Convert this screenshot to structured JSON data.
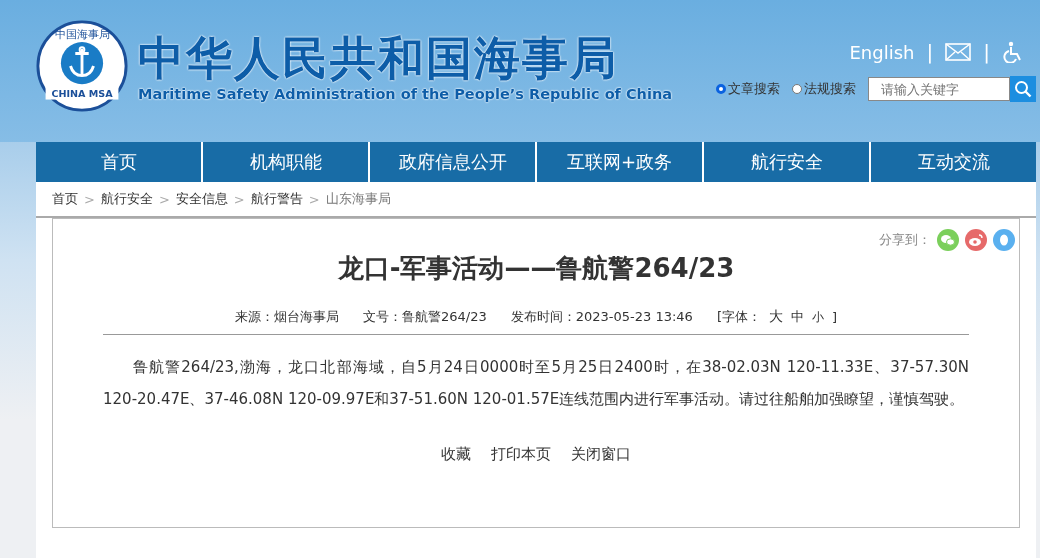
{
  "logo": {
    "ring_text": "中国海事局",
    "badge_text": "CHINA MSA"
  },
  "site": {
    "title": "中华人民共和国海事局",
    "subtitle": "Maritime Safety Administration of the People’s Republic of China"
  },
  "top_links": {
    "english": "English",
    "separator": "|"
  },
  "search": {
    "options": [
      {
        "label": "文章搜索",
        "selected": true
      },
      {
        "label": "法规搜索",
        "selected": false
      }
    ],
    "placeholder": "请输入关键字"
  },
  "nav": [
    {
      "label": "首页"
    },
    {
      "label": "机构职能"
    },
    {
      "label": "政府信息公开"
    },
    {
      "label": "互联网+政务"
    },
    {
      "label": "航行安全"
    },
    {
      "label": "互动交流"
    }
  ],
  "breadcrumb": {
    "separator": ">",
    "items": [
      "首页",
      "航行安全",
      "安全信息",
      "航行警告",
      "山东海事局"
    ]
  },
  "share": {
    "label": "分享到："
  },
  "article": {
    "title": "龙口-军事活动——鲁航警264/23",
    "meta": [
      "来源：烟台海事局",
      "文号：鲁航警264/23",
      "发布时间：2023-05-23 13:46"
    ],
    "font_size": {
      "label": "[字体：",
      "options": [
        "大",
        "中",
        "小"
      ],
      "close": "]"
    },
    "body": "鲁航警264/23,渤海，龙口北部海域，自5月24日0000时至5月25日2400时，在38-02.03N 120-11.33E、37-57.30N 120-20.47E、37-46.08N 120-09.97E和37-51.60N 120-01.57E连线范围内进行军事活动。请过往船舶加强瞭望，谨慎驾驶。",
    "actions": [
      "收藏",
      "打印本页",
      "关闭窗口"
    ]
  }
}
